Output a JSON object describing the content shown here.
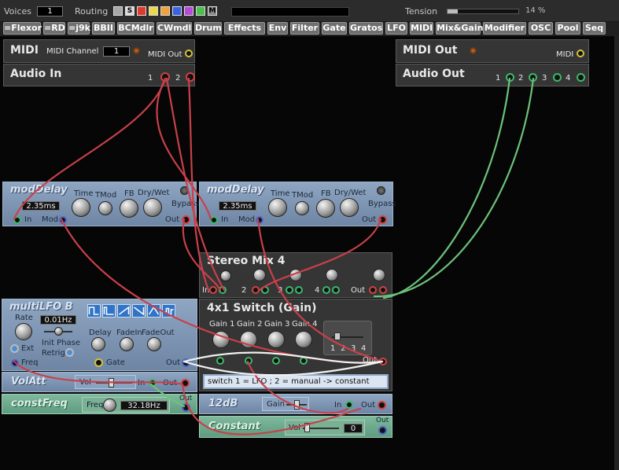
{
  "topbar": {
    "voices_label": "Voices",
    "voices_value": "1",
    "routing_label": "Routing",
    "swatches": [
      {
        "c": "#a8a8a8",
        "t": ""
      },
      {
        "c": "#dcdcdc",
        "t": "S"
      },
      {
        "c": "#e23a2a",
        "t": ""
      },
      {
        "c": "#e8d84a",
        "t": ""
      },
      {
        "c": "#f2a23a",
        "t": ""
      },
      {
        "c": "#3a62e6",
        "t": ""
      },
      {
        "c": "#b84ad8",
        "t": ""
      },
      {
        "c": "#48c24a",
        "t": ""
      },
      {
        "c": "#8a8a8a",
        "t": "M"
      }
    ],
    "tension_label": "Tension",
    "tension_value": "14 %",
    "tension_fraction": 0.14
  },
  "modules": [
    "=Flexor",
    "=RD",
    "=j9k",
    "BBII",
    "BCMdlr",
    "CWmdl",
    "Drum",
    "Effects",
    "Env",
    "Filter",
    "Gate",
    "Gratos",
    "LFO",
    "MIDI",
    "Mix&Gain",
    "Modifier",
    "OSC",
    "Pool",
    "Seq"
  ],
  "midi_in": {
    "title": "MIDI",
    "channel_label": "MIDI Channel",
    "channel_value": "1",
    "out_label": "MIDI Out"
  },
  "audio_in": {
    "title": "Audio In",
    "p1": "1",
    "p2": "2"
  },
  "midi_out": {
    "title": "MIDI Out",
    "midi_label": "MIDI"
  },
  "audio_out": {
    "title": "Audio Out",
    "p1": "1",
    "p2": "2",
    "p3": "3",
    "p4": "4"
  },
  "moddelay1": {
    "title": "modDelay",
    "time_label": "Time",
    "value": "2.35ms",
    "tmod": "TMod",
    "fb": "FB",
    "drywet": "Dry/Wet",
    "bypass": "Bypass",
    "in": "In",
    "mod": "Mod",
    "out": "Out"
  },
  "moddelay2": {
    "title": "modDelay",
    "time_label": "Time",
    "value": "2.35ms",
    "tmod": "TMod",
    "fb": "FB",
    "drywet": "Dry/Wet",
    "bypass": "Bypass",
    "in": "In",
    "mod": "Mod",
    "out": "Out"
  },
  "stereomix": {
    "title": "Stereo Mix 4",
    "in": "In",
    "n2": "2",
    "n3": "3",
    "n4": "4",
    "out": "Out"
  },
  "switch": {
    "title": "4x1 Switch (Gain)",
    "g1": "Gain 1",
    "g2": "Gain 2",
    "g3": "Gain 3",
    "g4": "Gain 4",
    "s1": "1",
    "s2": "2",
    "s3": "3",
    "s4": "4",
    "out": "Out",
    "note": "switch 1 = LFO ; 2 = manual -> constant"
  },
  "multilfo": {
    "title": "multiLFO B",
    "rate": "Rate",
    "rate_value": "0.01Hz",
    "init_phase": "Init Phase",
    "retrig": "Retrig",
    "ext": "Ext",
    "delay": "Delay",
    "fadein": "FadeIn",
    "fadeout": "FadeOut",
    "freq": "Freq",
    "gate": "Gate",
    "out": "Out"
  },
  "volatt": {
    "title": "VolAtt",
    "vol": "Vol",
    "in": "In",
    "out": "Out",
    "value": 0.4
  },
  "constfreq": {
    "title": "constFreq",
    "freq": "Freq",
    "value": "32.18Hz",
    "out": "Out"
  },
  "db12": {
    "title": "12dB",
    "gain": "Gain",
    "in": "In",
    "out": "Out",
    "value": 0.5
  },
  "constant": {
    "title": "Constant",
    "vol": "Vol",
    "value": "0",
    "out": "Out"
  },
  "colors": {
    "cable_red": "#c8404a",
    "cable_green": "#6cc27a",
    "cable_white": "#f0f0f0",
    "panel_blue": "#7e96b4",
    "panel_green": "#6fa98e",
    "panel_dark": "#353535"
  }
}
